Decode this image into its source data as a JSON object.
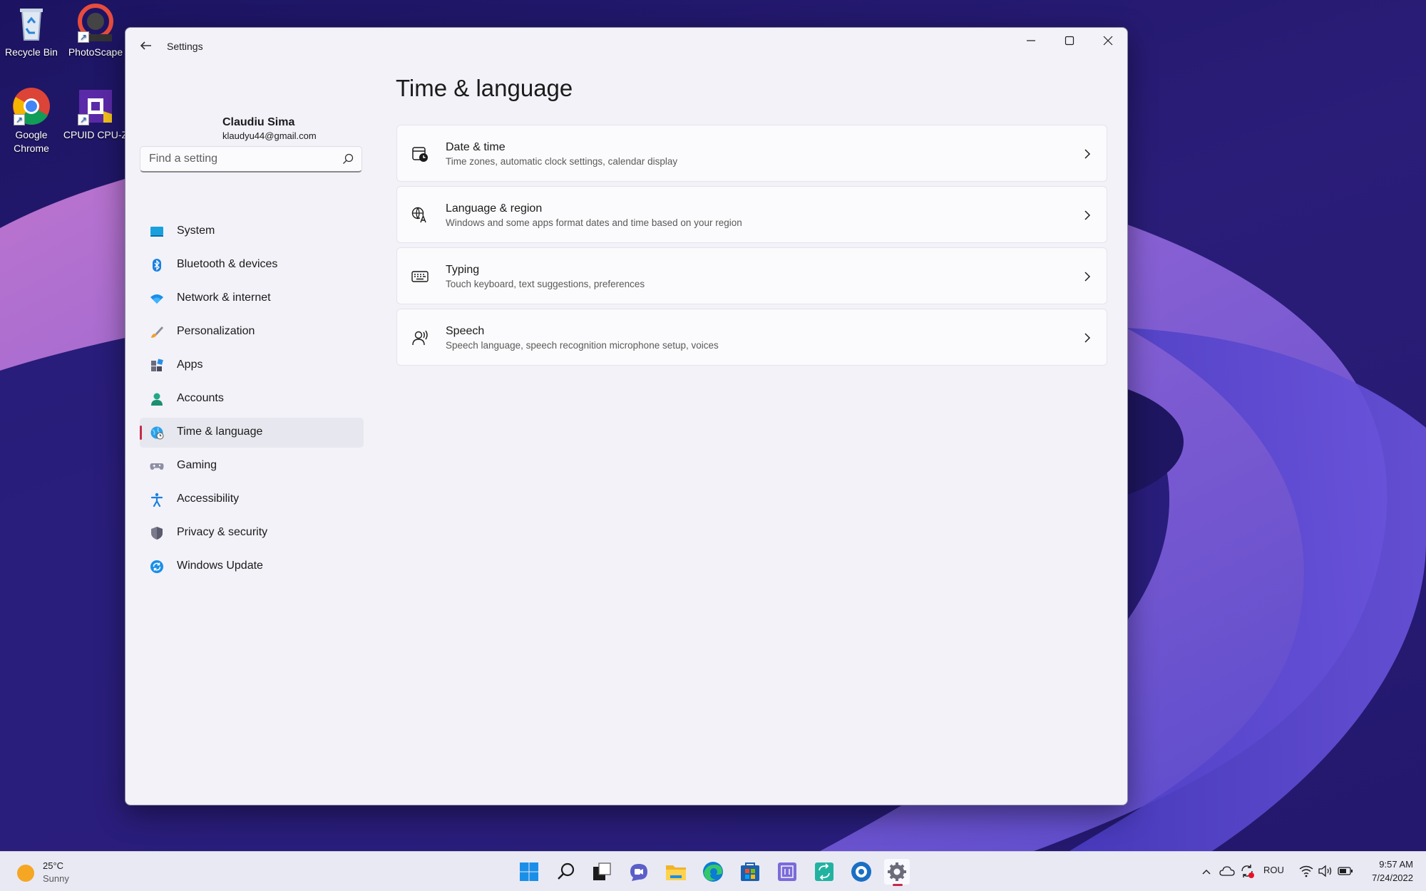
{
  "desktop": {
    "icons": [
      {
        "label": "Recycle Bin",
        "icon": "recycle-bin-icon"
      },
      {
        "label": "PhotoScape",
        "icon": "photoscape-icon"
      },
      {
        "label": "Google Chrome",
        "icon": "chrome-icon"
      },
      {
        "label": "CPUID CPU-Z",
        "icon": "cpu-z-icon"
      }
    ]
  },
  "window": {
    "app_title": "Settings",
    "controls": {
      "minimize": "minimize-icon",
      "maximize": "maximize-icon",
      "close": "close-icon"
    }
  },
  "profile": {
    "name": "Claudiu Sima",
    "email": "klaudyu44@gmail.com"
  },
  "search": {
    "placeholder": "Find a setting",
    "value": ""
  },
  "sidebar": {
    "items": [
      {
        "label": "System",
        "icon": "system-icon",
        "active": false
      },
      {
        "label": "Bluetooth & devices",
        "icon": "bluetooth-icon",
        "active": false
      },
      {
        "label": "Network & internet",
        "icon": "wifi-icon",
        "active": false
      },
      {
        "label": "Personalization",
        "icon": "brush-icon",
        "active": false
      },
      {
        "label": "Apps",
        "icon": "apps-icon",
        "active": false
      },
      {
        "label": "Accounts",
        "icon": "accounts-icon",
        "active": false
      },
      {
        "label": "Time & language",
        "icon": "globe-clock-icon",
        "active": true
      },
      {
        "label": "Gaming",
        "icon": "gamepad-icon",
        "active": false
      },
      {
        "label": "Accessibility",
        "icon": "accessibility-icon",
        "active": false
      },
      {
        "label": "Privacy & security",
        "icon": "shield-icon",
        "active": false
      },
      {
        "label": "Windows Update",
        "icon": "update-icon",
        "active": false
      }
    ]
  },
  "main": {
    "title": "Time & language",
    "cards": [
      {
        "title": "Date & time",
        "description": "Time zones, automatic clock settings, calendar display",
        "icon": "calendar-clock-icon"
      },
      {
        "title": "Language & region",
        "description": "Windows and some apps format dates and time based on your region",
        "icon": "language-icon"
      },
      {
        "title": "Typing",
        "description": "Touch keyboard, text suggestions, preferences",
        "icon": "keyboard-icon"
      },
      {
        "title": "Speech",
        "description": "Speech language, speech recognition microphone setup, voices",
        "icon": "speech-icon"
      }
    ]
  },
  "taskbar": {
    "weather": {
      "temp": "25°C",
      "condition": "Sunny"
    },
    "apps": [
      "start-icon",
      "search-icon",
      "task-view-icon",
      "chat-icon",
      "file-explorer-icon",
      "edge-icon",
      "store-icon",
      "widgets-icon",
      "sync-app-icon",
      "media-app-icon",
      "settings-icon"
    ],
    "tray": {
      "language": "ROU",
      "time": "9:57 AM",
      "date": "7/24/2022"
    }
  },
  "colors": {
    "accent": "#c42b4a",
    "window_bg": "#f2f2f8",
    "wallpaper": "#221a70"
  }
}
